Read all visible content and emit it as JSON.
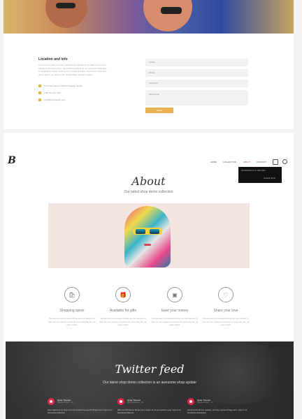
{
  "contact": {
    "title": "Location and info",
    "text": "Lorem ipsum dolor sit amet, consectetur adipiscing elit. Etiam fermentum massa ac molestie lorem, nisl eleifend semper at nec pharetra. Phasellus in vestibulum massa. Proin at mi in viverra at tellus vitae luctus. Duis quis varius lectus, ac ultrices nisl. Suspendisse pharetra sapien.",
    "address": "124 Some Street, 80000 Vergada, Serbia",
    "phone": "+381 60 1111 000",
    "email": "bizz@bizzydesign.com",
    "fields": {
      "name": "NAME",
      "email": "EMAIL",
      "subject": "SUBJECT",
      "message": "MESSAGE"
    },
    "send": "SEND"
  },
  "nav": {
    "logo": "B",
    "items": [
      "HOME",
      "COLLECTION",
      "ABOUT",
      "CONTACT"
    ],
    "active": "ABOUT"
  },
  "dropdown": {
    "line1": "NO PRODUCTS IN THE CART",
    "line2": "Subtotal: $0.00"
  },
  "about": {
    "title": "About",
    "subtitle": "Our latest shop demo collection"
  },
  "features": [
    {
      "icon": "shopping-bag-icon",
      "title": "Shopping spree",
      "text": "Sometimes the simplest things are the hardest to find. So we created a new line for everyday life, all year round."
    },
    {
      "icon": "gift-icon",
      "title": "Available for gifts",
      "text": "Sometimes the simplest things are the hardest to find. So we created a new line for everyday life, all year round."
    },
    {
      "icon": "money-icon",
      "title": "Save your money",
      "text": "Sometimes the simplest things are the hardest to find. So we created a new line for everyday life, all year round."
    },
    {
      "icon": "heart-icon",
      "title": "Share your love",
      "text": "Sometimes the simplest things are the hardest to find. So we created a new line for everyday life, all year round."
    }
  ],
  "twitter": {
    "title": "Twitter feed",
    "subtitle": "Our latest shop demo collection is an awesome shop update",
    "tweets": [
      {
        "name": "Qode Themes",
        "handle": "@QodeThemes · 2d",
        "text": "Take a glance at our blog to find out all about the powerful Bridge theme https://t.co/ #themeforest #themes"
      },
      {
        "name": "Qode Themes",
        "handle": "@QodeThemes · 2d",
        "text": "With over 100 demos, Bridge has a solution for all your website needs. https://t.co/ #wordpress #themes"
      },
      {
        "name": "Qode Themes",
        "handle": "@QodeThemes · 2d",
        "text": "Check out the all new, updated, and fully revamped Bridge demo. https://t.co/ #wordpress #webdesign"
      }
    ]
  },
  "colors": {
    "accent": "#e8b04f",
    "nav_active": "#e8445a",
    "twitter_avatar": "#e5264d"
  }
}
